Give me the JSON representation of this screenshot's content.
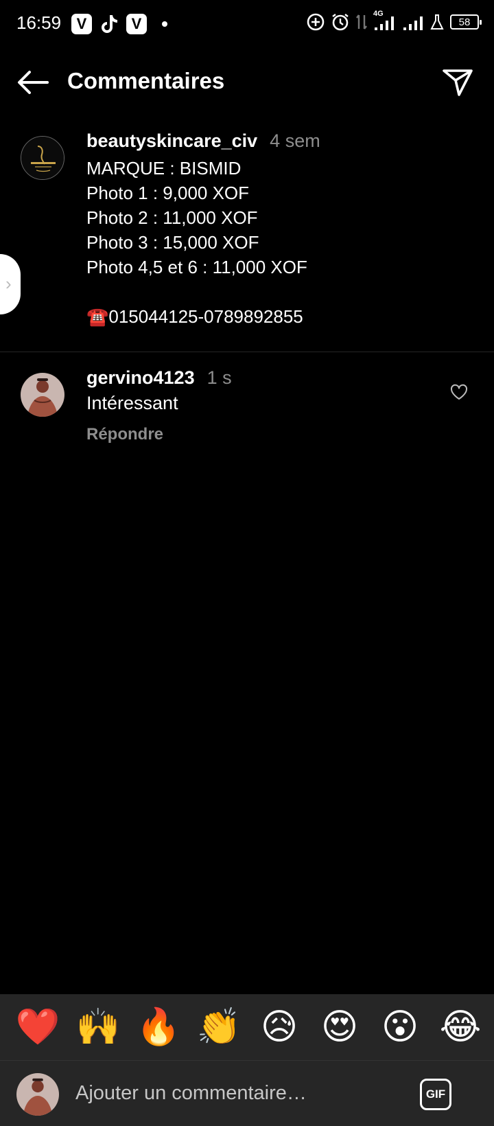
{
  "status_bar": {
    "time": "16:59",
    "left_icons": [
      "v-app-icon",
      "tiktok-icon",
      "v-app-icon",
      "notification-dot"
    ],
    "right_icons": [
      "add-circle-icon",
      "alarm-icon",
      "data-transfer-icon",
      "signal-4g-icon",
      "signal-icon",
      "lab-icon"
    ],
    "network_label": "4G",
    "battery_level": "58"
  },
  "header": {
    "title": "Commentaires"
  },
  "caption": {
    "username": "beautyskincare_civ",
    "time_ago": "4 sem",
    "lines": [
      "MARQUE : BISMID",
      "Photo 1 : 9,000 XOF",
      "Photo 2 : 11,000 XOF",
      "Photo 3 : 15,000 XOF",
      "Photo 4,5 et 6 : 11,000 XOF",
      "",
      "☎️015044125-0789892855"
    ]
  },
  "comment": {
    "username": "gervino4123",
    "time_ago": "1 s",
    "text": "Intéressant",
    "reply_label": "Répondre"
  },
  "emoji_bar": {
    "emojis": [
      "❤️",
      "🙌",
      "🔥",
      "👏",
      "😥",
      "😍",
      "😮",
      "😂"
    ]
  },
  "composer": {
    "placeholder": "Ajouter un commentaire…",
    "gif_label": "GIF"
  },
  "colors": {
    "background": "#000000",
    "muted_text": "#8e8e8e",
    "bar_background": "#262626"
  }
}
